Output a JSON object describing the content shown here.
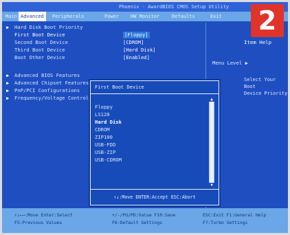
{
  "title": "Phoenix - AwardBIOS CMOS Setup Utility",
  "menu": [
    {
      "label": "Main",
      "active": false
    },
    {
      "label": "Advanced",
      "active": true
    },
    {
      "label": "Peripherals",
      "active": false
    },
    {
      "label": "Power",
      "active": false
    },
    {
      "label": "HW Monitor",
      "active": false
    },
    {
      "label": "Defaults",
      "active": false
    },
    {
      "label": "Exit",
      "active": false
    }
  ],
  "badge": "2",
  "left_items": [
    {
      "arrow": "▶",
      "label": "Hard Disk Boot Priority",
      "value": ""
    },
    {
      "arrow": "",
      "label": "First Boot Device",
      "value": "[Floppy]"
    },
    {
      "arrow": "",
      "label": "Second Boot Device",
      "value": "[CDROM]"
    },
    {
      "arrow": "",
      "label": "Third Boot Device",
      "value": "[Hard Disk]"
    },
    {
      "arrow": "",
      "label": "Boot Other Device",
      "value": "[Enabled]"
    },
    {
      "arrow": "",
      "label": "",
      "value": ""
    },
    {
      "arrow": "▶",
      "label": "Advanced BIOS Features",
      "value": ""
    },
    {
      "arrow": "▶",
      "label": "Advanced Chipset Features",
      "value": ""
    },
    {
      "arrow": "▶",
      "label": "PnP/PCI Configurations",
      "value": ""
    },
    {
      "arrow": "▶",
      "label": "Frequency/Voltage Control",
      "value": ""
    }
  ],
  "right": {
    "item_help": "Item Help",
    "menu_level": "Menu Level  ▶",
    "help_line1": "Select Your Boot",
    "help_line2": "Device Priority"
  },
  "popup": {
    "title": "First Boot Device",
    "options": [
      "Floppy",
      "LS120",
      "Hard Disk",
      "CDROM",
      "ZIP100",
      "USB-FDD",
      "USB-ZIP",
      "USB-CDROM"
    ],
    "selected_index": 2,
    "footer": "↑↓:Move ENTER:Accept ESC:Abort"
  },
  "keys": {
    "k1": "↑↓←→:Move  Enter:Select",
    "k2": "+/-/PU/PD:Value  F10:Save",
    "k3": "ESC:Exit  F1:General Help",
    "k4": "F5:Previous Values",
    "k5": "F6:Default Settings",
    "k6": "F7:Turbo Settings"
  }
}
